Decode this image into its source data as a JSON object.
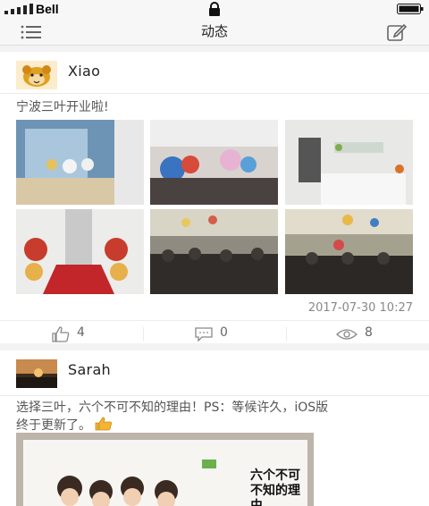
{
  "status_bar": {
    "carrier": "Bell",
    "signal_icon": "signal-bars-icon",
    "lock_icon": "lock-icon",
    "battery_icon": "battery-icon"
  },
  "nav": {
    "title": "动态",
    "menu_icon": "list-icon",
    "compose_icon": "compose-icon"
  },
  "posts": [
    {
      "username": "Xiao",
      "text": "宁波三叶开业啦!",
      "photos": [
        "classroom-photo",
        "party-photo",
        "reception-photo",
        "flowers-entrance-photo",
        "crowd-photo",
        "crowd-balloons-photo"
      ],
      "timestamp": "2017-07-30 10:27",
      "likes": "4",
      "comments": "0",
      "views": "8"
    },
    {
      "username": "Sarah",
      "text_line1": "选择三叶，六个不可不知的理由！PS：等候许久，iOS版",
      "text_line2": "终于更新了。",
      "photo_caption": "六个不可不知的理由"
    }
  ]
}
